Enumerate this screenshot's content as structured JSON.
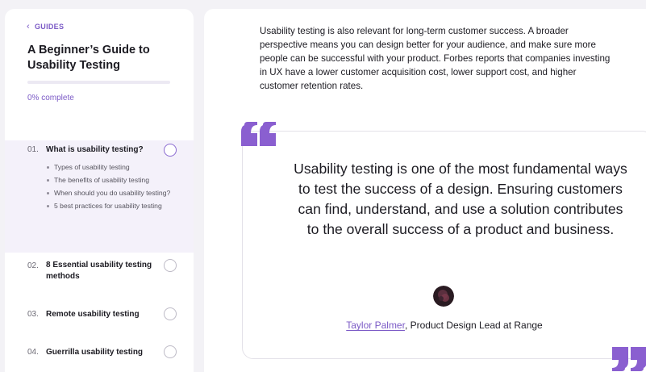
{
  "sidebar": {
    "back_label": "GUIDES",
    "guide_title": "A Beginner’s Guide to Usability Testing",
    "progress_percent": 0,
    "progress_text": "0% complete",
    "chapters": [
      {
        "number": "01.",
        "title": "What is usability testing?",
        "subsections": [
          "Types of usability testing",
          "The benefits of usability testing",
          "When should you do usability testing?",
          "5 best practices for usability testing"
        ]
      },
      {
        "number": "02.",
        "title": "8 Essential usability testing methods"
      },
      {
        "number": "03.",
        "title": "Remote usability testing"
      },
      {
        "number": "04.",
        "title": "Guerrilla usability testing"
      }
    ]
  },
  "main": {
    "intro_paragraph": "Usability testing is also relevant for long-term customer success. A broader perspective means you can design better for your audience, and make sure more people can be successful with your product. Forbes reports that companies investing in UX have a lower customer acquisition cost, lower support cost, and higher customer retention rates.",
    "quote": {
      "text": "Usability testing is one of the most fundamental ways to test the success of a design. Ensuring customers can find, understand, and use a solution contributes to the overall success of a product and business.",
      "author_name": "Taylor Palmer",
      "author_role": ", Product Design Lead at Range"
    }
  },
  "colors": {
    "accent": "#7b5ac6",
    "quote_mark": "#8a5fd0",
    "active_chapter_bg": "#f4f1fa"
  },
  "icons": {
    "back": "chevron-left-icon",
    "chapter_status": "circle-outline-icon",
    "quote_open": "quote-open-icon",
    "quote_close": "quote-close-icon"
  }
}
